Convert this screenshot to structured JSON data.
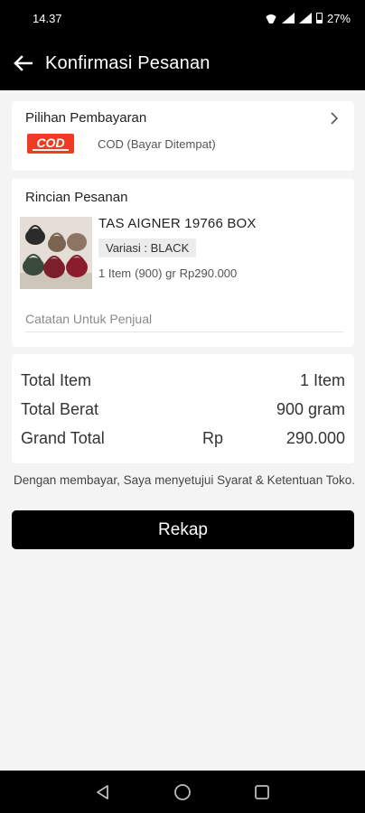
{
  "status_bar": {
    "time": "14.37",
    "battery": "27%",
    "icons": [
      "wifi-icon",
      "signal-icon",
      "signal-icon",
      "battery-icon"
    ]
  },
  "header": {
    "title": "Konfirmasi Pesanan",
    "back_icon": "arrow-left-icon"
  },
  "payment": {
    "label": "Pilihan Pembayaran",
    "logo_text": "COD",
    "method": "COD (Bayar Ditempat)",
    "chevron_icon": "chevron-right-icon"
  },
  "order": {
    "label": "Rincian Pesanan",
    "product_name": "TAS AIGNER 19766 BOX",
    "variant": "Variasi : BLACK",
    "quantity": "1 Item",
    "weight": "(900) gr",
    "price": "Rp290.000",
    "note_placeholder": "Catatan Untuk Penjual"
  },
  "summary": {
    "total_item_label": "Total Item",
    "total_item_value": "1 Item",
    "total_weight_label": "Total Berat",
    "total_weight_value": "900 gram",
    "grand_total_label": "Grand Total",
    "grand_total_currency": "Rp",
    "grand_total_value": "290.000"
  },
  "agreement_text": "Dengan membayar, Saya menyetujui Syarat & Ketentuan Toko.",
  "submit_label": "Rekap",
  "colors": {
    "header_bg": "#000000",
    "button_bg": "#000000",
    "cod_red": "#ef3b24",
    "page_bg": "#f4f4f4"
  }
}
